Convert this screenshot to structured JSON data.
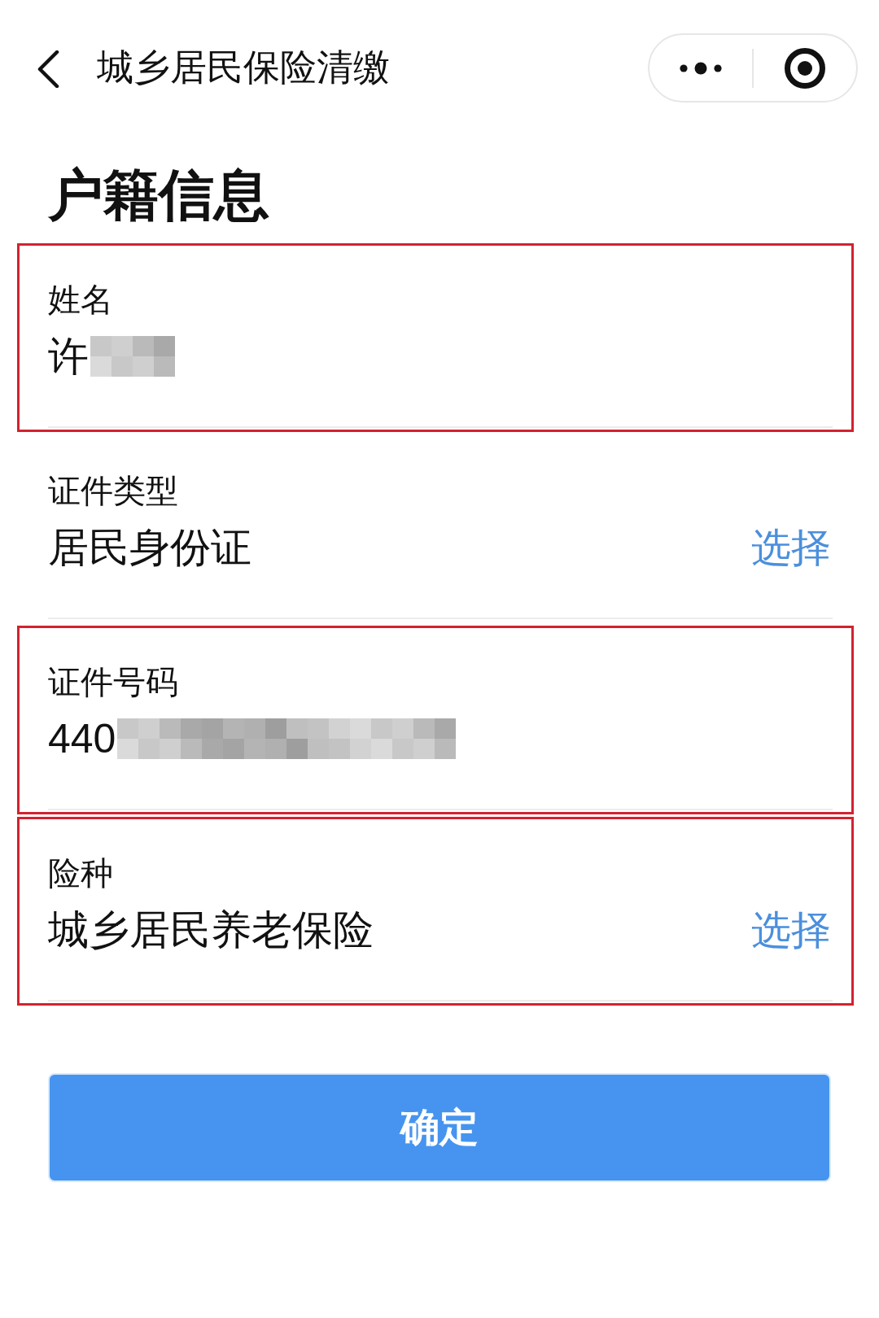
{
  "nav": {
    "title": "城乡居民保险清缴"
  },
  "heading": "户籍信息",
  "fields": [
    {
      "kind": "text",
      "label": "姓名",
      "value": "许",
      "redacted": true,
      "highlighted": true
    },
    {
      "kind": "picker",
      "label": "证件类型",
      "value": "居民身份证",
      "action": "选择",
      "highlighted": false
    },
    {
      "kind": "text",
      "label": "证件号码",
      "value": "440",
      "redacted": true,
      "highlighted": true
    },
    {
      "kind": "picker",
      "label": "险种",
      "value": "城乡居民养老保险",
      "action": "选择",
      "highlighted": true
    }
  ],
  "submit_button": {
    "label": "确定"
  }
}
